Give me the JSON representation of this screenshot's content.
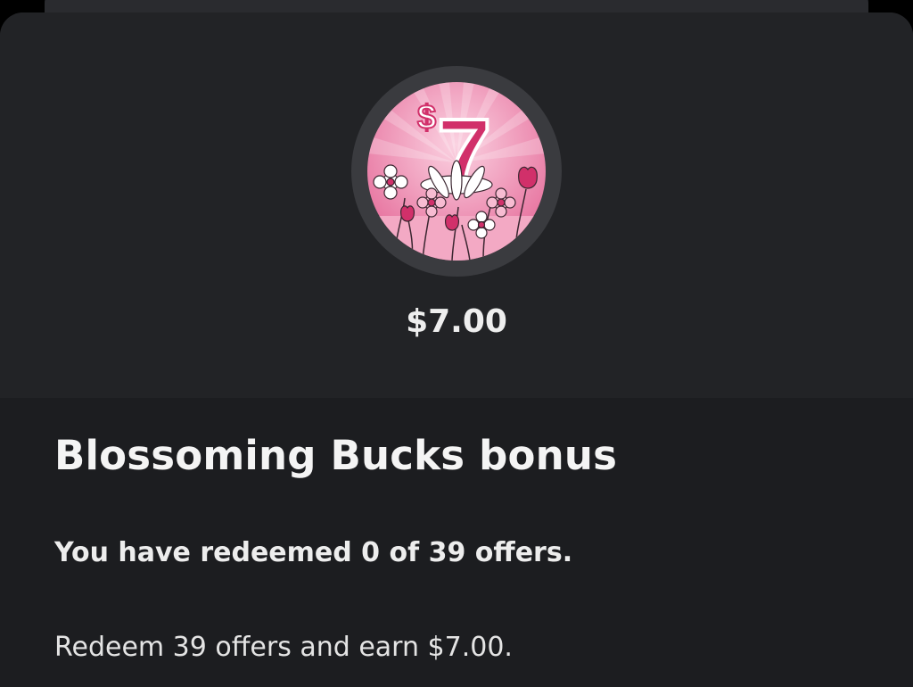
{
  "badge": {
    "icon": "blossoming-bucks-badge-icon",
    "currency_symbol": "$",
    "number": "7",
    "colors": {
      "ring": "#3a3b3f",
      "pink_bg": "#e87fa6",
      "number": "#d1306a"
    }
  },
  "reward": {
    "amount": "$7.00"
  },
  "bonus": {
    "title": "Blossoming Bucks bonus",
    "progress_text": "You have redeemed 0 of 39 offers.",
    "redeemed": 0,
    "total": 39,
    "description": "Redeem 39 offers and earn $7.00."
  }
}
